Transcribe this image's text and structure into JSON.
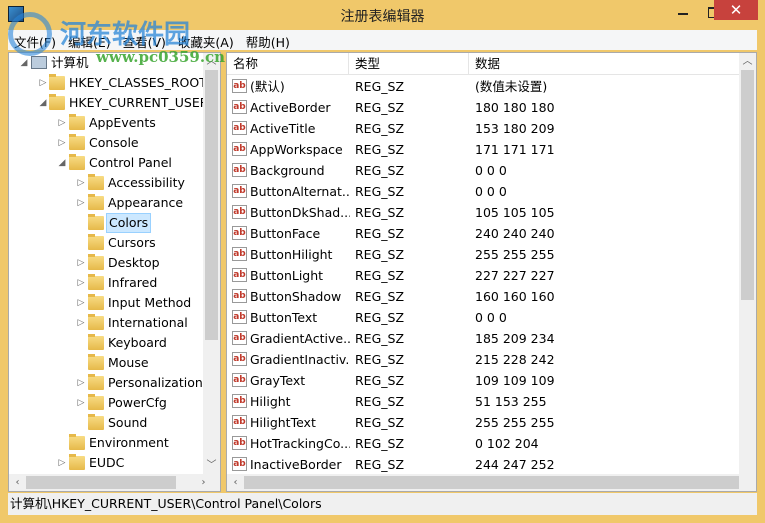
{
  "window": {
    "title": "注册表编辑器",
    "border_color": "#f0c86a",
    "close_color": "#c7423d"
  },
  "menu": [
    "文件(F)",
    "编辑(E)",
    "查看(V)",
    "收藏夹(A)",
    "帮助(H)"
  ],
  "watermark": {
    "name": "河东软件园",
    "url": "www.pc0359.cn"
  },
  "tree": [
    {
      "label": "计算机",
      "level": 0,
      "state": "expanded",
      "icon": "computer-icon"
    },
    {
      "label": "HKEY_CLASSES_ROOT",
      "level": 1,
      "state": "collapsed"
    },
    {
      "label": "HKEY_CURRENT_USER",
      "level": 1,
      "state": "expanded"
    },
    {
      "label": "AppEvents",
      "level": 2,
      "state": "collapsed"
    },
    {
      "label": "Console",
      "level": 2,
      "state": "collapsed"
    },
    {
      "label": "Control Panel",
      "level": 2,
      "state": "expanded"
    },
    {
      "label": "Accessibility",
      "level": 3,
      "state": "collapsed"
    },
    {
      "label": "Appearance",
      "level": 3,
      "state": "collapsed"
    },
    {
      "label": "Colors",
      "level": 3,
      "state": "leaf",
      "selected": true
    },
    {
      "label": "Cursors",
      "level": 3,
      "state": "leaf"
    },
    {
      "label": "Desktop",
      "level": 3,
      "state": "collapsed"
    },
    {
      "label": "Infrared",
      "level": 3,
      "state": "collapsed"
    },
    {
      "label": "Input Method",
      "level": 3,
      "state": "collapsed"
    },
    {
      "label": "International",
      "level": 3,
      "state": "collapsed"
    },
    {
      "label": "Keyboard",
      "level": 3,
      "state": "leaf"
    },
    {
      "label": "Mouse",
      "level": 3,
      "state": "leaf"
    },
    {
      "label": "Personalization",
      "level": 3,
      "state": "collapsed"
    },
    {
      "label": "PowerCfg",
      "level": 3,
      "state": "collapsed"
    },
    {
      "label": "Sound",
      "level": 3,
      "state": "leaf"
    },
    {
      "label": "Environment",
      "level": 2,
      "state": "leaf"
    },
    {
      "label": "EUDC",
      "level": 2,
      "state": "collapsed"
    }
  ],
  "columns": [
    "名称",
    "类型",
    "数据"
  ],
  "values": [
    {
      "name": "(默认)",
      "type": "REG_SZ",
      "data": "(数值未设置)"
    },
    {
      "name": "ActiveBorder",
      "type": "REG_SZ",
      "data": "180 180 180"
    },
    {
      "name": "ActiveTitle",
      "type": "REG_SZ",
      "data": "153 180 209"
    },
    {
      "name": "AppWorkspace",
      "type": "REG_SZ",
      "data": "171 171 171"
    },
    {
      "name": "Background",
      "type": "REG_SZ",
      "data": "0 0 0"
    },
    {
      "name": "ButtonAlternat...",
      "type": "REG_SZ",
      "data": "0 0 0"
    },
    {
      "name": "ButtonDkShad...",
      "type": "REG_SZ",
      "data": "105 105 105"
    },
    {
      "name": "ButtonFace",
      "type": "REG_SZ",
      "data": "240 240 240"
    },
    {
      "name": "ButtonHilight",
      "type": "REG_SZ",
      "data": "255 255 255"
    },
    {
      "name": "ButtonLight",
      "type": "REG_SZ",
      "data": "227 227 227"
    },
    {
      "name": "ButtonShadow",
      "type": "REG_SZ",
      "data": "160 160 160"
    },
    {
      "name": "ButtonText",
      "type": "REG_SZ",
      "data": "0 0 0"
    },
    {
      "name": "GradientActive...",
      "type": "REG_SZ",
      "data": "185 209 234"
    },
    {
      "name": "GradientInactiv...",
      "type": "REG_SZ",
      "data": "215 228 242"
    },
    {
      "name": "GrayText",
      "type": "REG_SZ",
      "data": "109 109 109"
    },
    {
      "name": "Hilight",
      "type": "REG_SZ",
      "data": "51 153 255"
    },
    {
      "name": "HilightText",
      "type": "REG_SZ",
      "data": "255 255 255"
    },
    {
      "name": "HotTrackingCo...",
      "type": "REG_SZ",
      "data": "0 102 204"
    },
    {
      "name": "InactiveBorder",
      "type": "REG_SZ",
      "data": "244 247 252"
    }
  ],
  "value_icon_text": "ab",
  "status": "计算机\\HKEY_CURRENT_USER\\Control Panel\\Colors"
}
